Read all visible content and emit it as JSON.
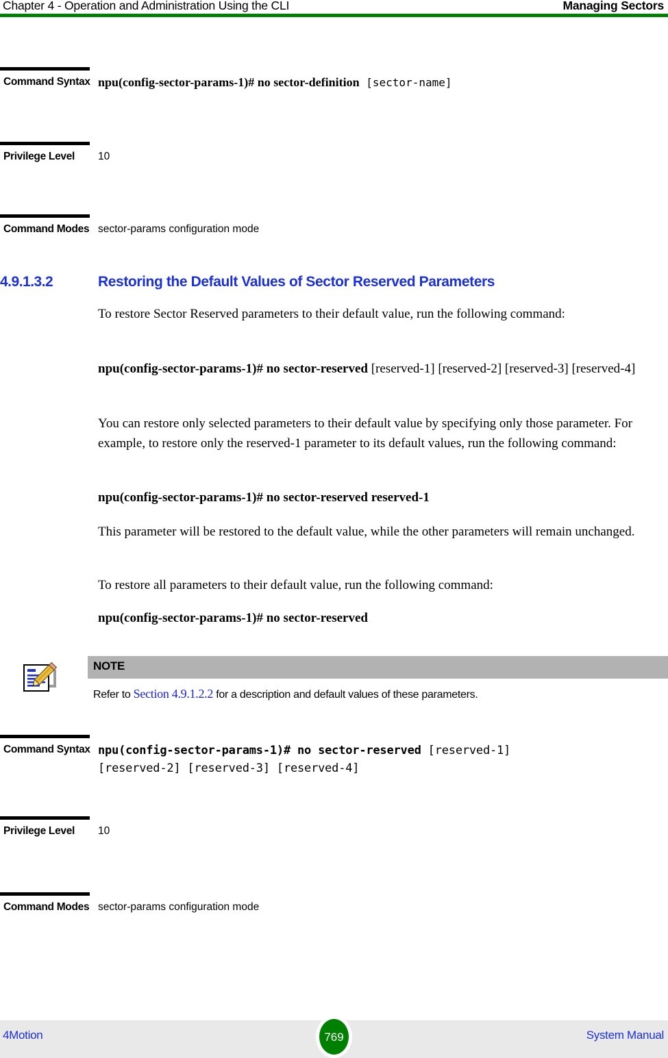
{
  "header": {
    "left": "Chapter 4 - Operation and Administration Using the CLI",
    "right": "Managing Sectors",
    "rule_color": "#008000"
  },
  "command_block_1": {
    "rows": [
      {
        "label": "Command Syntax",
        "value_bold": "npu(config-sector-params-1)# no sector-definition",
        "value_arg": "[sector-name]"
      },
      {
        "label": "Privilege Level",
        "value": "10"
      },
      {
        "label": "Command Modes",
        "value": "sector-params configuration mode"
      }
    ]
  },
  "section": {
    "number": "4.9.1.3.2",
    "title": "Restoring the Default Values of Sector Reserved Parameters",
    "color": "#1b30d8"
  },
  "body": {
    "para_1": "To restore Sector Reserved parameters to their default value, run the following command:",
    "cmd_1_bold": "npu(config-sector-params-1)# no sector-reserved",
    "cmd_1_args": " [reserved-1] [reserved-2] [reserved-3] [reserved-4]",
    "para_2": "You can restore only selected parameters to their default value by specifying only those parameter. For example, to restore only the reserved-1 parameter to its default values, run the following command:",
    "cmd_2": "npu(config-sector-params-1)# no sector-reserved reserved-1",
    "para_3": "This parameter will be restored to the default value, while the other parameters will remain unchanged.",
    "para_4": "To restore all parameters to their default value, run the following command:",
    "cmd_3": "npu(config-sector-params-1)# no sector-reserved"
  },
  "note": {
    "icon": "note-pencil-icon",
    "title": "NOTE",
    "text_before": "Refer to ",
    "link": "Section 4.9.1.2.2",
    "text_after": " for a description and default values of these parameters.",
    "header_bg": "#b2b2b2",
    "link_color": "#1b22e0"
  },
  "command_block_2": {
    "rows": [
      {
        "label": "Command Syntax",
        "value_bold": "npu(config-sector-params-1)# no sector-reserved",
        "value_arg_line1": " [reserved-1]",
        "value_arg_line2": "[reserved-2] [reserved-3] [reserved-4]"
      },
      {
        "label": "Privilege Level",
        "value": "10"
      },
      {
        "label": "Command Modes",
        "value": "sector-params configuration mode"
      }
    ]
  },
  "footer": {
    "left": "4Motion",
    "page_number": "769",
    "right": "System Manual",
    "bg": "#e9e9e9",
    "badge_color": "#008000",
    "link_color": "#1b30d8"
  }
}
